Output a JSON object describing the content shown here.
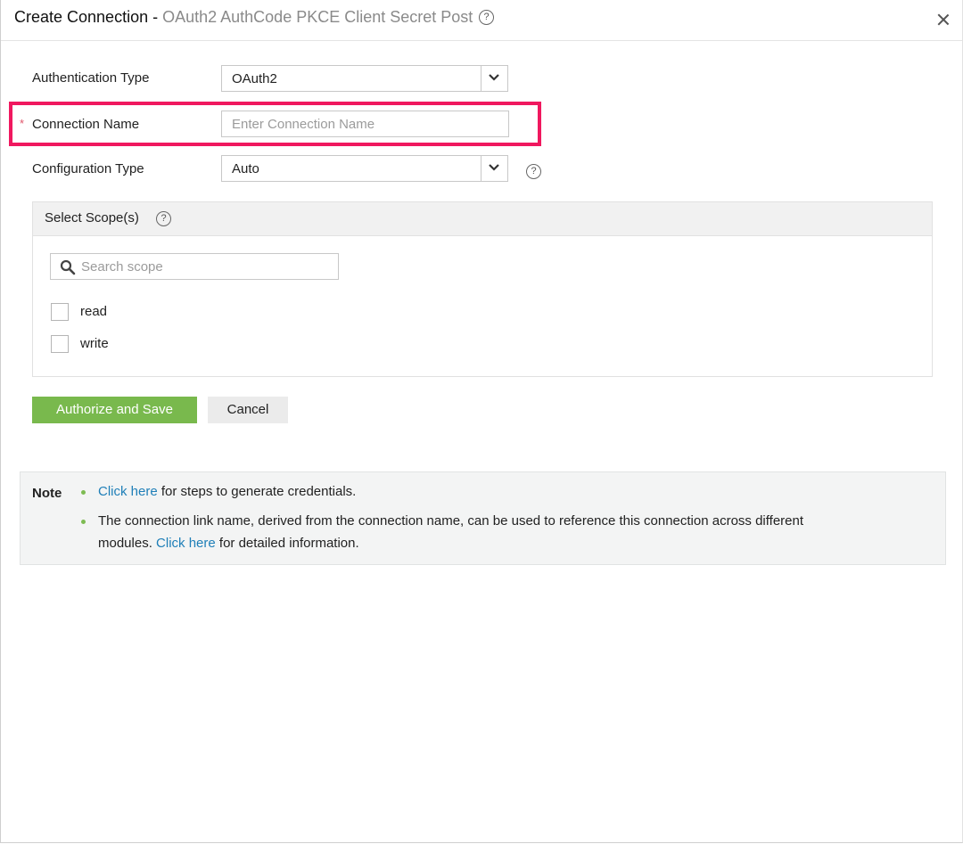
{
  "dialog": {
    "title": "Create Connection",
    "title_separator": " - ",
    "subtitle": "OAuth2 AuthCode PKCE Client Secret Post",
    "help_glyph": "?",
    "close_icon": "close-icon"
  },
  "form": {
    "auth_type_label": "Authentication Type",
    "auth_type_value": "OAuth2",
    "required_marker": "*",
    "connection_name_label": "Connection Name",
    "connection_name_value": "",
    "connection_name_placeholder": "Enter Connection Name",
    "config_type_label": "Configuration Type",
    "config_type_value": "Auto"
  },
  "scopes": {
    "header": "Select Scope(s)",
    "search_placeholder": "Search scope",
    "items": [
      {
        "label": "read",
        "checked": false
      },
      {
        "label": "write",
        "checked": false
      }
    ]
  },
  "actions": {
    "authorize_label": "Authorize and Save",
    "cancel_label": "Cancel"
  },
  "note": {
    "title": "Note",
    "line1_link": "Click here",
    "line1_text": " for steps to generate credentials.",
    "line2_text_a": "The connection link name, derived from the connection name, can be used to reference this connection across different",
    "line2_text_b": "modules. ",
    "line2_link": "Click here",
    "line2_text_c": " for detailed information."
  },
  "colors": {
    "primary_button": "#79b94d",
    "highlight_border": "#f0185f",
    "link": "#1f7fb8",
    "required_star": "#e0566b"
  }
}
